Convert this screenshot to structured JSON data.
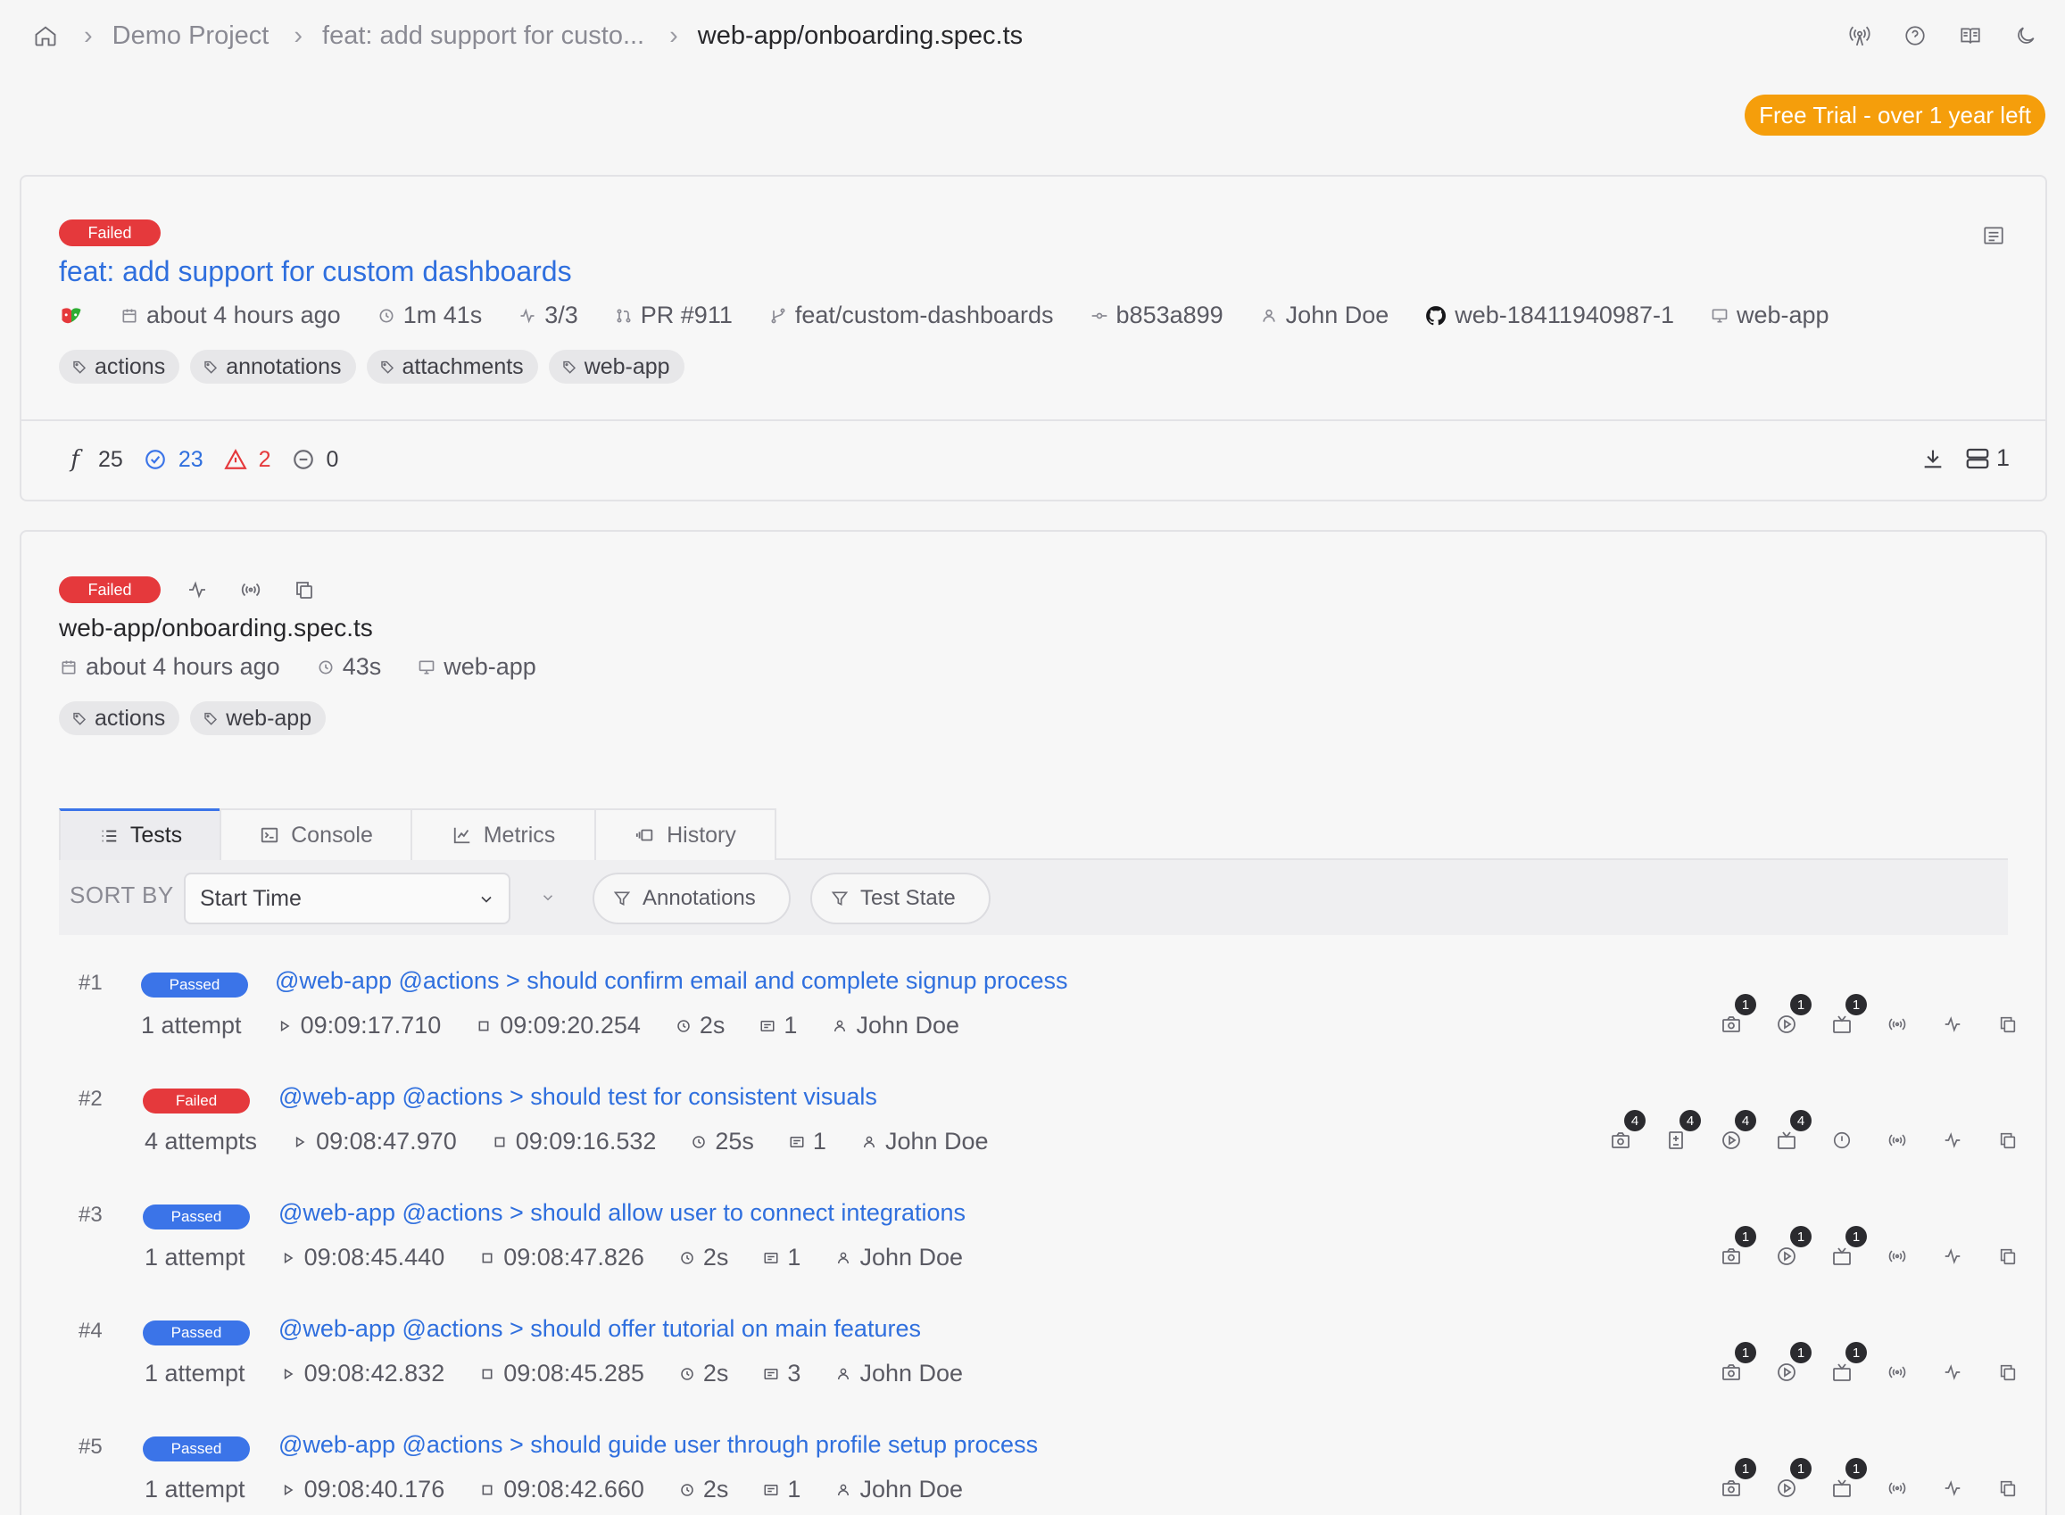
{
  "breadcrumb": {
    "items": [
      "Demo Project",
      "feat: add support for custo...",
      "web-app/onboarding.spec.ts"
    ]
  },
  "trial_badge": "Free Trial - over 1 year left",
  "run": {
    "status": "Failed",
    "title": "feat: add support for custom dashboards",
    "meta": {
      "time": "about 4 hours ago",
      "duration": "1m 41s",
      "shards": "3/3",
      "pr": "PR #911",
      "branch": "feat/custom-dashboards",
      "commit": "b853a899",
      "author": "John Doe",
      "ci_build": "web-18411940987-1",
      "group": "web-app"
    },
    "tags": [
      "actions",
      "annotations",
      "attachments",
      "web-app"
    ],
    "stats": {
      "total": "25",
      "passed": "23",
      "failed": "2",
      "skipped": "0"
    },
    "machines": "1"
  },
  "spec": {
    "status": "Failed",
    "file": "web-app/onboarding.spec.ts",
    "meta": {
      "time": "about 4 hours ago",
      "duration": "43s",
      "group": "web-app"
    },
    "tags": [
      "actions",
      "web-app"
    ]
  },
  "tabs": [
    "Tests",
    "Console",
    "Metrics",
    "History"
  ],
  "toolbar": {
    "sort_label": "SORT BY",
    "sort_value": "Start Time",
    "filter_annotations": "Annotations",
    "filter_state": "Test State"
  },
  "tests": [
    {
      "num": "#1",
      "status": "Passed",
      "name": "@web-app @actions > should confirm email and complete signup process",
      "attempts": "1 attempt",
      "start": "09:09:17.710",
      "end": "09:09:20.254",
      "duration": "2s",
      "logs": "1",
      "author": "John Doe"
    },
    {
      "num": "#2",
      "status": "Failed",
      "name": "@web-app @actions > should test for consistent visuals",
      "attempts": "4 attempts",
      "start": "09:08:47.970",
      "end": "09:09:16.532",
      "duration": "25s",
      "logs": "1",
      "author": "John Doe"
    },
    {
      "num": "#3",
      "status": "Passed",
      "name": "@web-app @actions > should allow user to connect integrations",
      "attempts": "1 attempt",
      "start": "09:08:45.440",
      "end": "09:08:47.826",
      "duration": "2s",
      "logs": "1",
      "author": "John Doe"
    },
    {
      "num": "#4",
      "status": "Passed",
      "name": "@web-app @actions > should offer tutorial on main features",
      "attempts": "1 attempt",
      "start": "09:08:42.832",
      "end": "09:08:45.285",
      "duration": "2s",
      "logs": "3",
      "author": "John Doe"
    },
    {
      "num": "#5",
      "status": "Passed",
      "name": "@web-app @actions > should guide user through profile setup process",
      "attempts": "1 attempt",
      "start": "09:08:40.176",
      "end": "09:08:42.660",
      "duration": "2s",
      "logs": "1",
      "author": "John Doe"
    }
  ],
  "attachment_counts": {
    "row1": [
      "1",
      "1",
      "1"
    ],
    "row2": [
      "4",
      "4",
      "4",
      "4"
    ],
    "row3": [
      "1",
      "1",
      "1"
    ],
    "row4": [
      "1",
      "1",
      "1"
    ],
    "row5": [
      "1",
      "1",
      "1"
    ]
  },
  "colors": {
    "accent": "#2f6fde",
    "failed": "#e5393c",
    "passed": "#3b74e8",
    "trial": "#f59e0b"
  }
}
